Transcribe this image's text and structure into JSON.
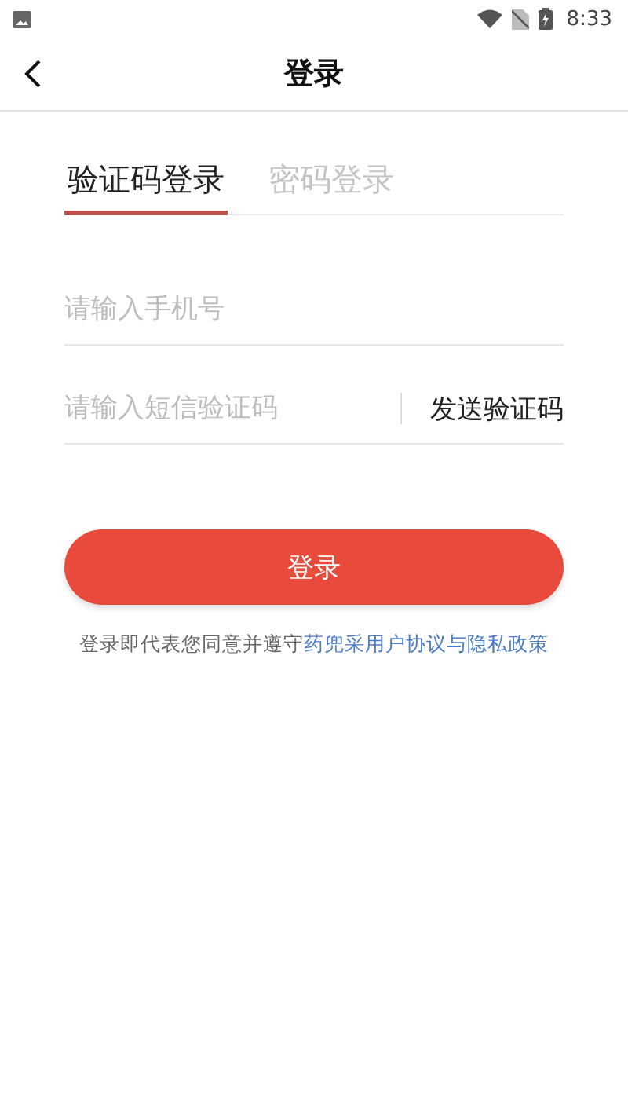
{
  "status_bar": {
    "time": "8:33"
  },
  "nav": {
    "title": "登录"
  },
  "tabs": [
    {
      "label": "验证码登录",
      "selected": true
    },
    {
      "label": "密码登录",
      "selected": false
    }
  ],
  "phone_field": {
    "placeholder": "请输入手机号"
  },
  "code_field": {
    "placeholder": "请输入短信验证码"
  },
  "send_code": "发送验证码",
  "login_button": "登录",
  "agreement": {
    "text": "登录即代表您同意并遵守",
    "link": "药兜采用户协议与隐私政策"
  }
}
